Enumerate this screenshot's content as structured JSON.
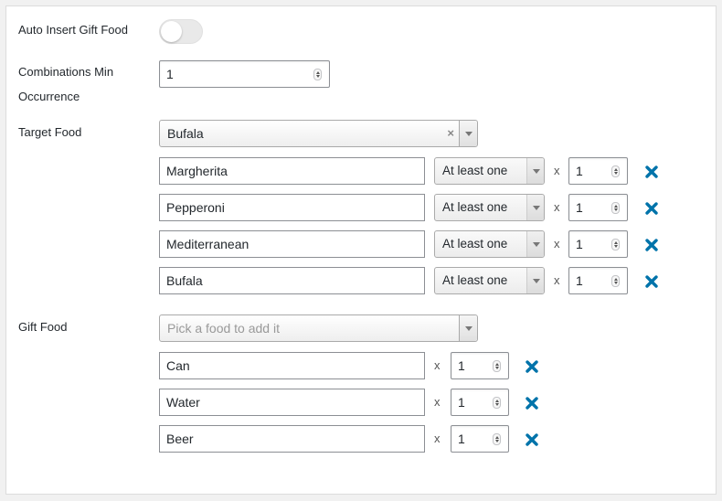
{
  "auto_insert": {
    "label": "Auto Insert Gift Food",
    "enabled": false
  },
  "combinations_min": {
    "label_line1": "Combinations Min",
    "label_line2": "Occurrence",
    "value": "1"
  },
  "target_food": {
    "label": "Target Food",
    "select_value": "Bufala",
    "clear_symbol": "×",
    "items": [
      {
        "name": "Margherita",
        "condition": "At least one",
        "times": "x",
        "qty": "1"
      },
      {
        "name": "Pepperoni",
        "condition": "At least one",
        "times": "x",
        "qty": "1"
      },
      {
        "name": "Mediterranean",
        "condition": "At least one",
        "times": "x",
        "qty": "1"
      },
      {
        "name": "Bufala",
        "condition": "At least one",
        "times": "x",
        "qty": "1"
      }
    ]
  },
  "gift_food": {
    "label": "Gift Food",
    "select_placeholder": "Pick a food to add it",
    "items": [
      {
        "name": "Can",
        "times": "x",
        "qty": "1"
      },
      {
        "name": "Water",
        "times": "x",
        "qty": "1"
      },
      {
        "name": "Beer",
        "times": "x",
        "qty": "1"
      }
    ]
  },
  "colors": {
    "remove_icon": "#0073aa",
    "panel_bg": "#ffffff",
    "page_bg": "#f1f1f1"
  }
}
